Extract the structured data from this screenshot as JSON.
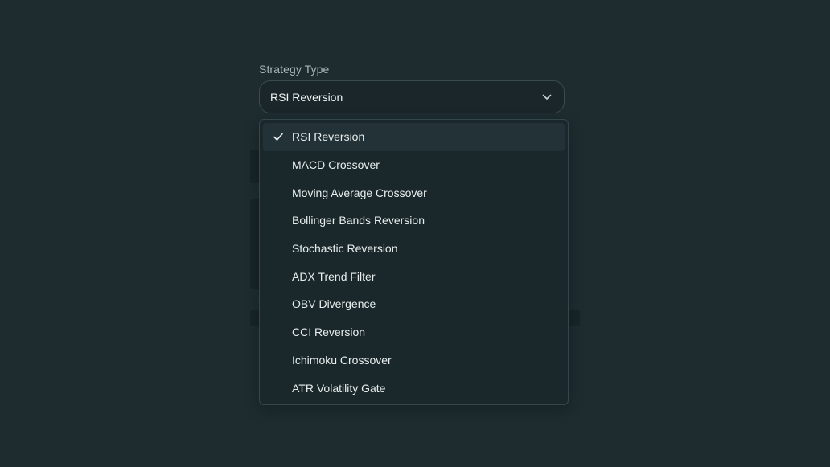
{
  "form": {
    "label": "Strategy Type",
    "selected_value": "RSI Reversion"
  },
  "dropdown": {
    "options": [
      {
        "label": "RSI Reversion",
        "selected": true
      },
      {
        "label": "MACD Crossover",
        "selected": false
      },
      {
        "label": "Moving Average Crossover",
        "selected": false
      },
      {
        "label": "Bollinger Bands Reversion",
        "selected": false
      },
      {
        "label": "Stochastic Reversion",
        "selected": false
      },
      {
        "label": "ADX Trend Filter",
        "selected": false
      },
      {
        "label": "OBV Divergence",
        "selected": false
      },
      {
        "label": "CCI Reversion",
        "selected": false
      },
      {
        "label": "Ichimoku Crossover",
        "selected": false
      },
      {
        "label": "ATR Volatility Gate",
        "selected": false
      }
    ]
  },
  "icons": {
    "trigger": "chevron-down-icon",
    "selected_marker": "check-icon"
  },
  "colors": {
    "background": "#1e2c2f",
    "surface": "#1b282b",
    "selected_row": "#223236",
    "text": "#e8eeee",
    "label_text": "#a9b6b7"
  }
}
